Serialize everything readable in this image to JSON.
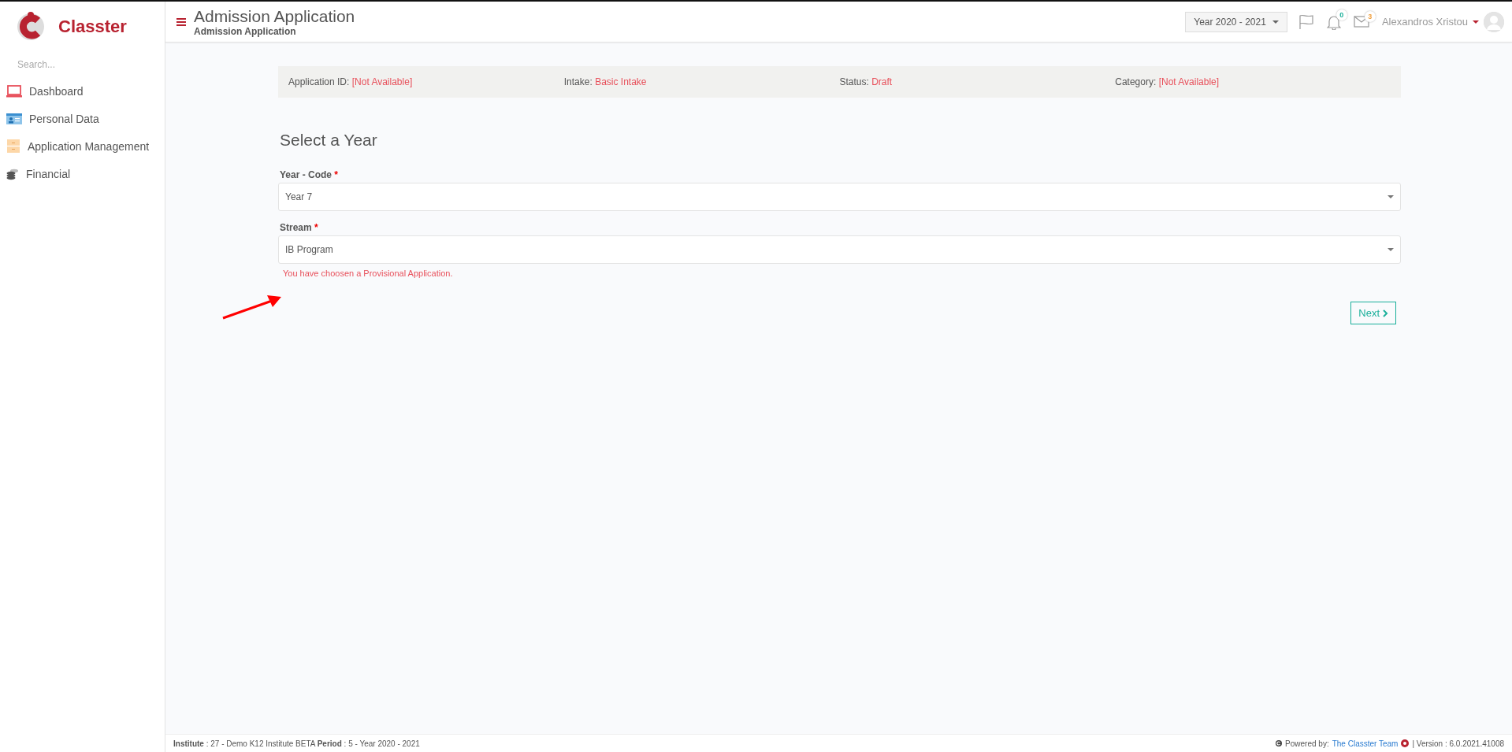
{
  "logo": {
    "text": "Classter"
  },
  "sidebar": {
    "search_placeholder": "Search...",
    "items": [
      {
        "label": "Dashboard",
        "kind": "laptop"
      },
      {
        "label": "Personal Data",
        "kind": "idcard"
      },
      {
        "label": "Application Management",
        "kind": "folder"
      },
      {
        "label": "Financial",
        "kind": "coins"
      }
    ]
  },
  "header": {
    "title": "Admission Application",
    "subtitle": "Admission Application",
    "year_selector": "Year 2020 - 2021",
    "notifications": "0",
    "messages": "3",
    "user": "Alexandros Xristou"
  },
  "info_bar": [
    {
      "label": "Application ID:",
      "value": "[Not Available]"
    },
    {
      "label": "Intake:",
      "value": "Basic Intake"
    },
    {
      "label": "Status:",
      "value": "Draft"
    },
    {
      "label": "Category:",
      "value": "[Not Available]"
    }
  ],
  "form": {
    "heading": "Select a Year",
    "fields": [
      {
        "label": "Year - Code",
        "required_mark": "*",
        "value": "Year 7"
      },
      {
        "label": "Stream",
        "required_mark": "*",
        "value": "IB Program"
      }
    ],
    "notice": "You have choosen a Provisional Application.",
    "next_button": "Next"
  },
  "footer": {
    "left": "**Institute** : 27 - Demo K12 Institute BETA **Period** : 5 - Year 2020 - 2021",
    "powered_label": "Powered by:",
    "powered_link": "The Classter Team",
    "version": "| Version : 6.0.2021.41008"
  }
}
